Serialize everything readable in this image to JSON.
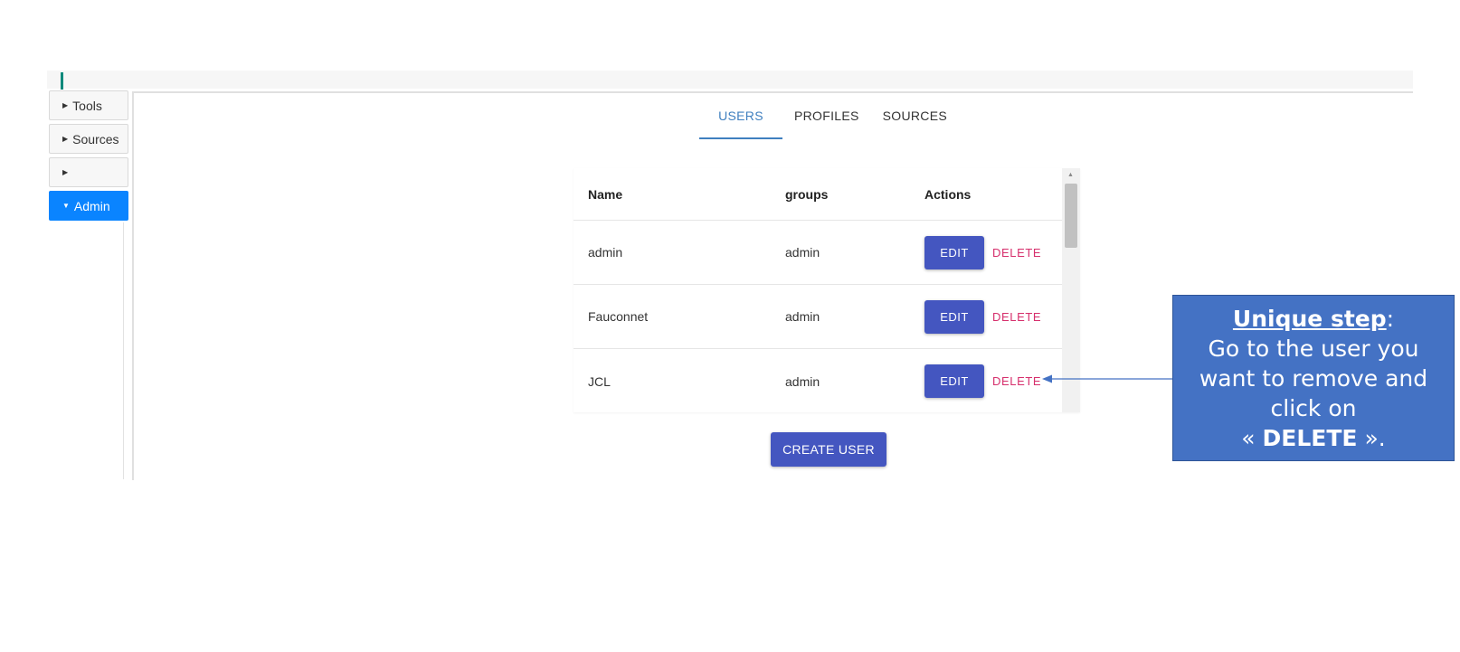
{
  "sidebar": {
    "items": [
      {
        "label": "Tools",
        "active": false
      },
      {
        "label": "Sources",
        "active": false
      },
      {
        "label": "",
        "active": false
      },
      {
        "label": "Admin",
        "active": true
      }
    ]
  },
  "tabs": [
    {
      "label": "USERS",
      "active": true
    },
    {
      "label": "PROFILES",
      "active": false
    },
    {
      "label": "SOURCES",
      "active": false
    }
  ],
  "table": {
    "headers": {
      "name": "Name",
      "groups": "groups",
      "actions": "Actions"
    },
    "rows": [
      {
        "name": "admin",
        "groups": "admin",
        "edit": "EDIT",
        "delete": "DELETE"
      },
      {
        "name": "Fauconnet",
        "groups": "admin",
        "edit": "EDIT",
        "delete": "DELETE"
      },
      {
        "name": "JCL",
        "groups": "admin",
        "edit": "EDIT",
        "delete": "DELETE"
      }
    ]
  },
  "create_button": "CREATE USER",
  "callout": {
    "title": "Unique step",
    "title_suffix": ":",
    "line1": "Go to the user you",
    "line2": "want to remove and",
    "line3": "click on",
    "quote_open": "« ",
    "action": "DELETE",
    "quote_close": " ».",
    "color": "#4472c4"
  },
  "colors": {
    "accent_active": "#0a84ff",
    "tab_active": "#3f7fbf",
    "primary_button": "#4456c0",
    "delete_text": "#d62f6c"
  },
  "icons": {
    "collapsed": "caret-right-icon",
    "expanded": "caret-down-icon"
  }
}
